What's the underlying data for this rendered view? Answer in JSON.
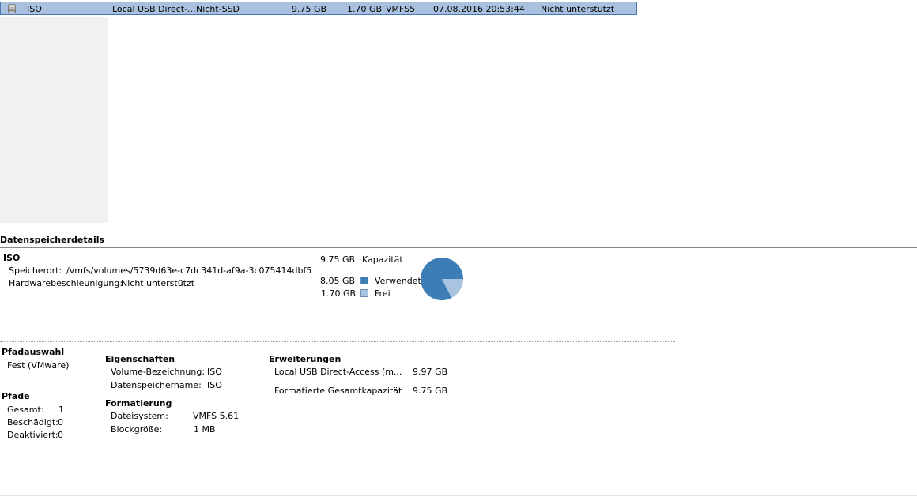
{
  "datastore_row": {
    "name": "ISO",
    "device": "Local USB Direct-...",
    "drive_type": "Nicht-SSD",
    "capacity": "9.75 GB",
    "free": "1.70 GB",
    "type": "VMFS5",
    "last_update": "07.08.2016 20:53:44",
    "hw_accel": "Nicht unterstützt"
  },
  "details": {
    "title": "Datenspeicherdetails",
    "name": "ISO",
    "location_label": "Speicherort:",
    "location_value": "/vmfs/volumes/5739d63e-c7dc341d-af9a-3c075414dbf5",
    "hw_label": "Hardwarebeschleunigung:",
    "hw_value": "Nicht unterstützt"
  },
  "capacity_chart": {
    "total_value": "9.75 GB",
    "total_label": "Kapazität",
    "used_value": "8.05 GB",
    "used_label": "Verwendet",
    "free_value": "1.70 GB",
    "free_label": "Frei",
    "used_color": "#3c7db5",
    "free_color": "#a8c4e0"
  },
  "chart_data": {
    "type": "pie",
    "categories": [
      "Verwendet",
      "Frei"
    ],
    "values": [
      8.05,
      1.7
    ],
    "title": "",
    "legend": "left"
  },
  "path_selection": {
    "title": "Pfadauswahl",
    "value": "Fest (VMware)"
  },
  "paths": {
    "title": "Pfade",
    "total_label": "Gesamt:",
    "total_value": "1",
    "broken_label": "Beschädigt:",
    "broken_value": "0",
    "disabled_label": "Deaktiviert:",
    "disabled_value": "0"
  },
  "properties": {
    "title": "Eigenschaften",
    "volume_label": "Volume-Bezeichnung:",
    "volume_value": "ISO",
    "ds_name_label": "Datenspeichername:",
    "ds_name_value": "ISO"
  },
  "formatting": {
    "title": "Formatierung",
    "fs_label": "Dateisystem:",
    "fs_value": "VMFS 5.61",
    "block_label": "Blockgröße:",
    "block_value": "1 MB"
  },
  "extents": {
    "title": "Erweiterungen",
    "item_label": "Local USB Direct-Access (m...",
    "item_value": "9.97 GB",
    "total_label": "Formatierte Gesamtkapazität",
    "total_value": "9.75 GB"
  }
}
